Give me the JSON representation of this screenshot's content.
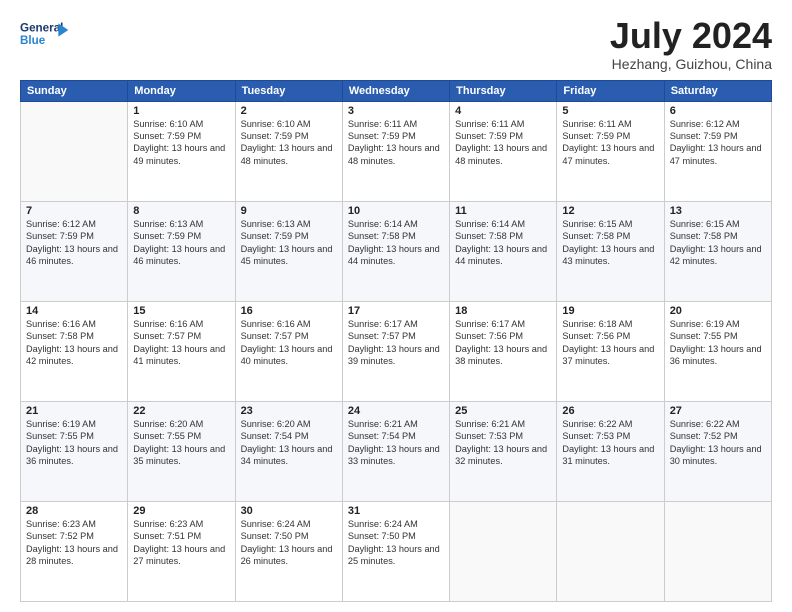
{
  "logo": {
    "line1": "General",
    "line2": "Blue"
  },
  "title": "July 2024",
  "location": "Hezhang, Guizhou, China",
  "days_of_week": [
    "Sunday",
    "Monday",
    "Tuesday",
    "Wednesday",
    "Thursday",
    "Friday",
    "Saturday"
  ],
  "weeks": [
    [
      {
        "day": "",
        "info": ""
      },
      {
        "day": "1",
        "info": "Sunrise: 6:10 AM\nSunset: 7:59 PM\nDaylight: 13 hours\nand 49 minutes."
      },
      {
        "day": "2",
        "info": "Sunrise: 6:10 AM\nSunset: 7:59 PM\nDaylight: 13 hours\nand 48 minutes."
      },
      {
        "day": "3",
        "info": "Sunrise: 6:11 AM\nSunset: 7:59 PM\nDaylight: 13 hours\nand 48 minutes."
      },
      {
        "day": "4",
        "info": "Sunrise: 6:11 AM\nSunset: 7:59 PM\nDaylight: 13 hours\nand 48 minutes."
      },
      {
        "day": "5",
        "info": "Sunrise: 6:11 AM\nSunset: 7:59 PM\nDaylight: 13 hours\nand 47 minutes."
      },
      {
        "day": "6",
        "info": "Sunrise: 6:12 AM\nSunset: 7:59 PM\nDaylight: 13 hours\nand 47 minutes."
      }
    ],
    [
      {
        "day": "7",
        "info": "Sunrise: 6:12 AM\nSunset: 7:59 PM\nDaylight: 13 hours\nand 46 minutes."
      },
      {
        "day": "8",
        "info": "Sunrise: 6:13 AM\nSunset: 7:59 PM\nDaylight: 13 hours\nand 46 minutes."
      },
      {
        "day": "9",
        "info": "Sunrise: 6:13 AM\nSunset: 7:59 PM\nDaylight: 13 hours\nand 45 minutes."
      },
      {
        "day": "10",
        "info": "Sunrise: 6:14 AM\nSunset: 7:58 PM\nDaylight: 13 hours\nand 44 minutes."
      },
      {
        "day": "11",
        "info": "Sunrise: 6:14 AM\nSunset: 7:58 PM\nDaylight: 13 hours\nand 44 minutes."
      },
      {
        "day": "12",
        "info": "Sunrise: 6:15 AM\nSunset: 7:58 PM\nDaylight: 13 hours\nand 43 minutes."
      },
      {
        "day": "13",
        "info": "Sunrise: 6:15 AM\nSunset: 7:58 PM\nDaylight: 13 hours\nand 42 minutes."
      }
    ],
    [
      {
        "day": "14",
        "info": "Sunrise: 6:16 AM\nSunset: 7:58 PM\nDaylight: 13 hours\nand 42 minutes."
      },
      {
        "day": "15",
        "info": "Sunrise: 6:16 AM\nSunset: 7:57 PM\nDaylight: 13 hours\nand 41 minutes."
      },
      {
        "day": "16",
        "info": "Sunrise: 6:16 AM\nSunset: 7:57 PM\nDaylight: 13 hours\nand 40 minutes."
      },
      {
        "day": "17",
        "info": "Sunrise: 6:17 AM\nSunset: 7:57 PM\nDaylight: 13 hours\nand 39 minutes."
      },
      {
        "day": "18",
        "info": "Sunrise: 6:17 AM\nSunset: 7:56 PM\nDaylight: 13 hours\nand 38 minutes."
      },
      {
        "day": "19",
        "info": "Sunrise: 6:18 AM\nSunset: 7:56 PM\nDaylight: 13 hours\nand 37 minutes."
      },
      {
        "day": "20",
        "info": "Sunrise: 6:19 AM\nSunset: 7:55 PM\nDaylight: 13 hours\nand 36 minutes."
      }
    ],
    [
      {
        "day": "21",
        "info": "Sunrise: 6:19 AM\nSunset: 7:55 PM\nDaylight: 13 hours\nand 36 minutes."
      },
      {
        "day": "22",
        "info": "Sunrise: 6:20 AM\nSunset: 7:55 PM\nDaylight: 13 hours\nand 35 minutes."
      },
      {
        "day": "23",
        "info": "Sunrise: 6:20 AM\nSunset: 7:54 PM\nDaylight: 13 hours\nand 34 minutes."
      },
      {
        "day": "24",
        "info": "Sunrise: 6:21 AM\nSunset: 7:54 PM\nDaylight: 13 hours\nand 33 minutes."
      },
      {
        "day": "25",
        "info": "Sunrise: 6:21 AM\nSunset: 7:53 PM\nDaylight: 13 hours\nand 32 minutes."
      },
      {
        "day": "26",
        "info": "Sunrise: 6:22 AM\nSunset: 7:53 PM\nDaylight: 13 hours\nand 31 minutes."
      },
      {
        "day": "27",
        "info": "Sunrise: 6:22 AM\nSunset: 7:52 PM\nDaylight: 13 hours\nand 30 minutes."
      }
    ],
    [
      {
        "day": "28",
        "info": "Sunrise: 6:23 AM\nSunset: 7:52 PM\nDaylight: 13 hours\nand 28 minutes."
      },
      {
        "day": "29",
        "info": "Sunrise: 6:23 AM\nSunset: 7:51 PM\nDaylight: 13 hours\nand 27 minutes."
      },
      {
        "day": "30",
        "info": "Sunrise: 6:24 AM\nSunset: 7:50 PM\nDaylight: 13 hours\nand 26 minutes."
      },
      {
        "day": "31",
        "info": "Sunrise: 6:24 AM\nSunset: 7:50 PM\nDaylight: 13 hours\nand 25 minutes."
      },
      {
        "day": "",
        "info": ""
      },
      {
        "day": "",
        "info": ""
      },
      {
        "day": "",
        "info": ""
      }
    ]
  ]
}
